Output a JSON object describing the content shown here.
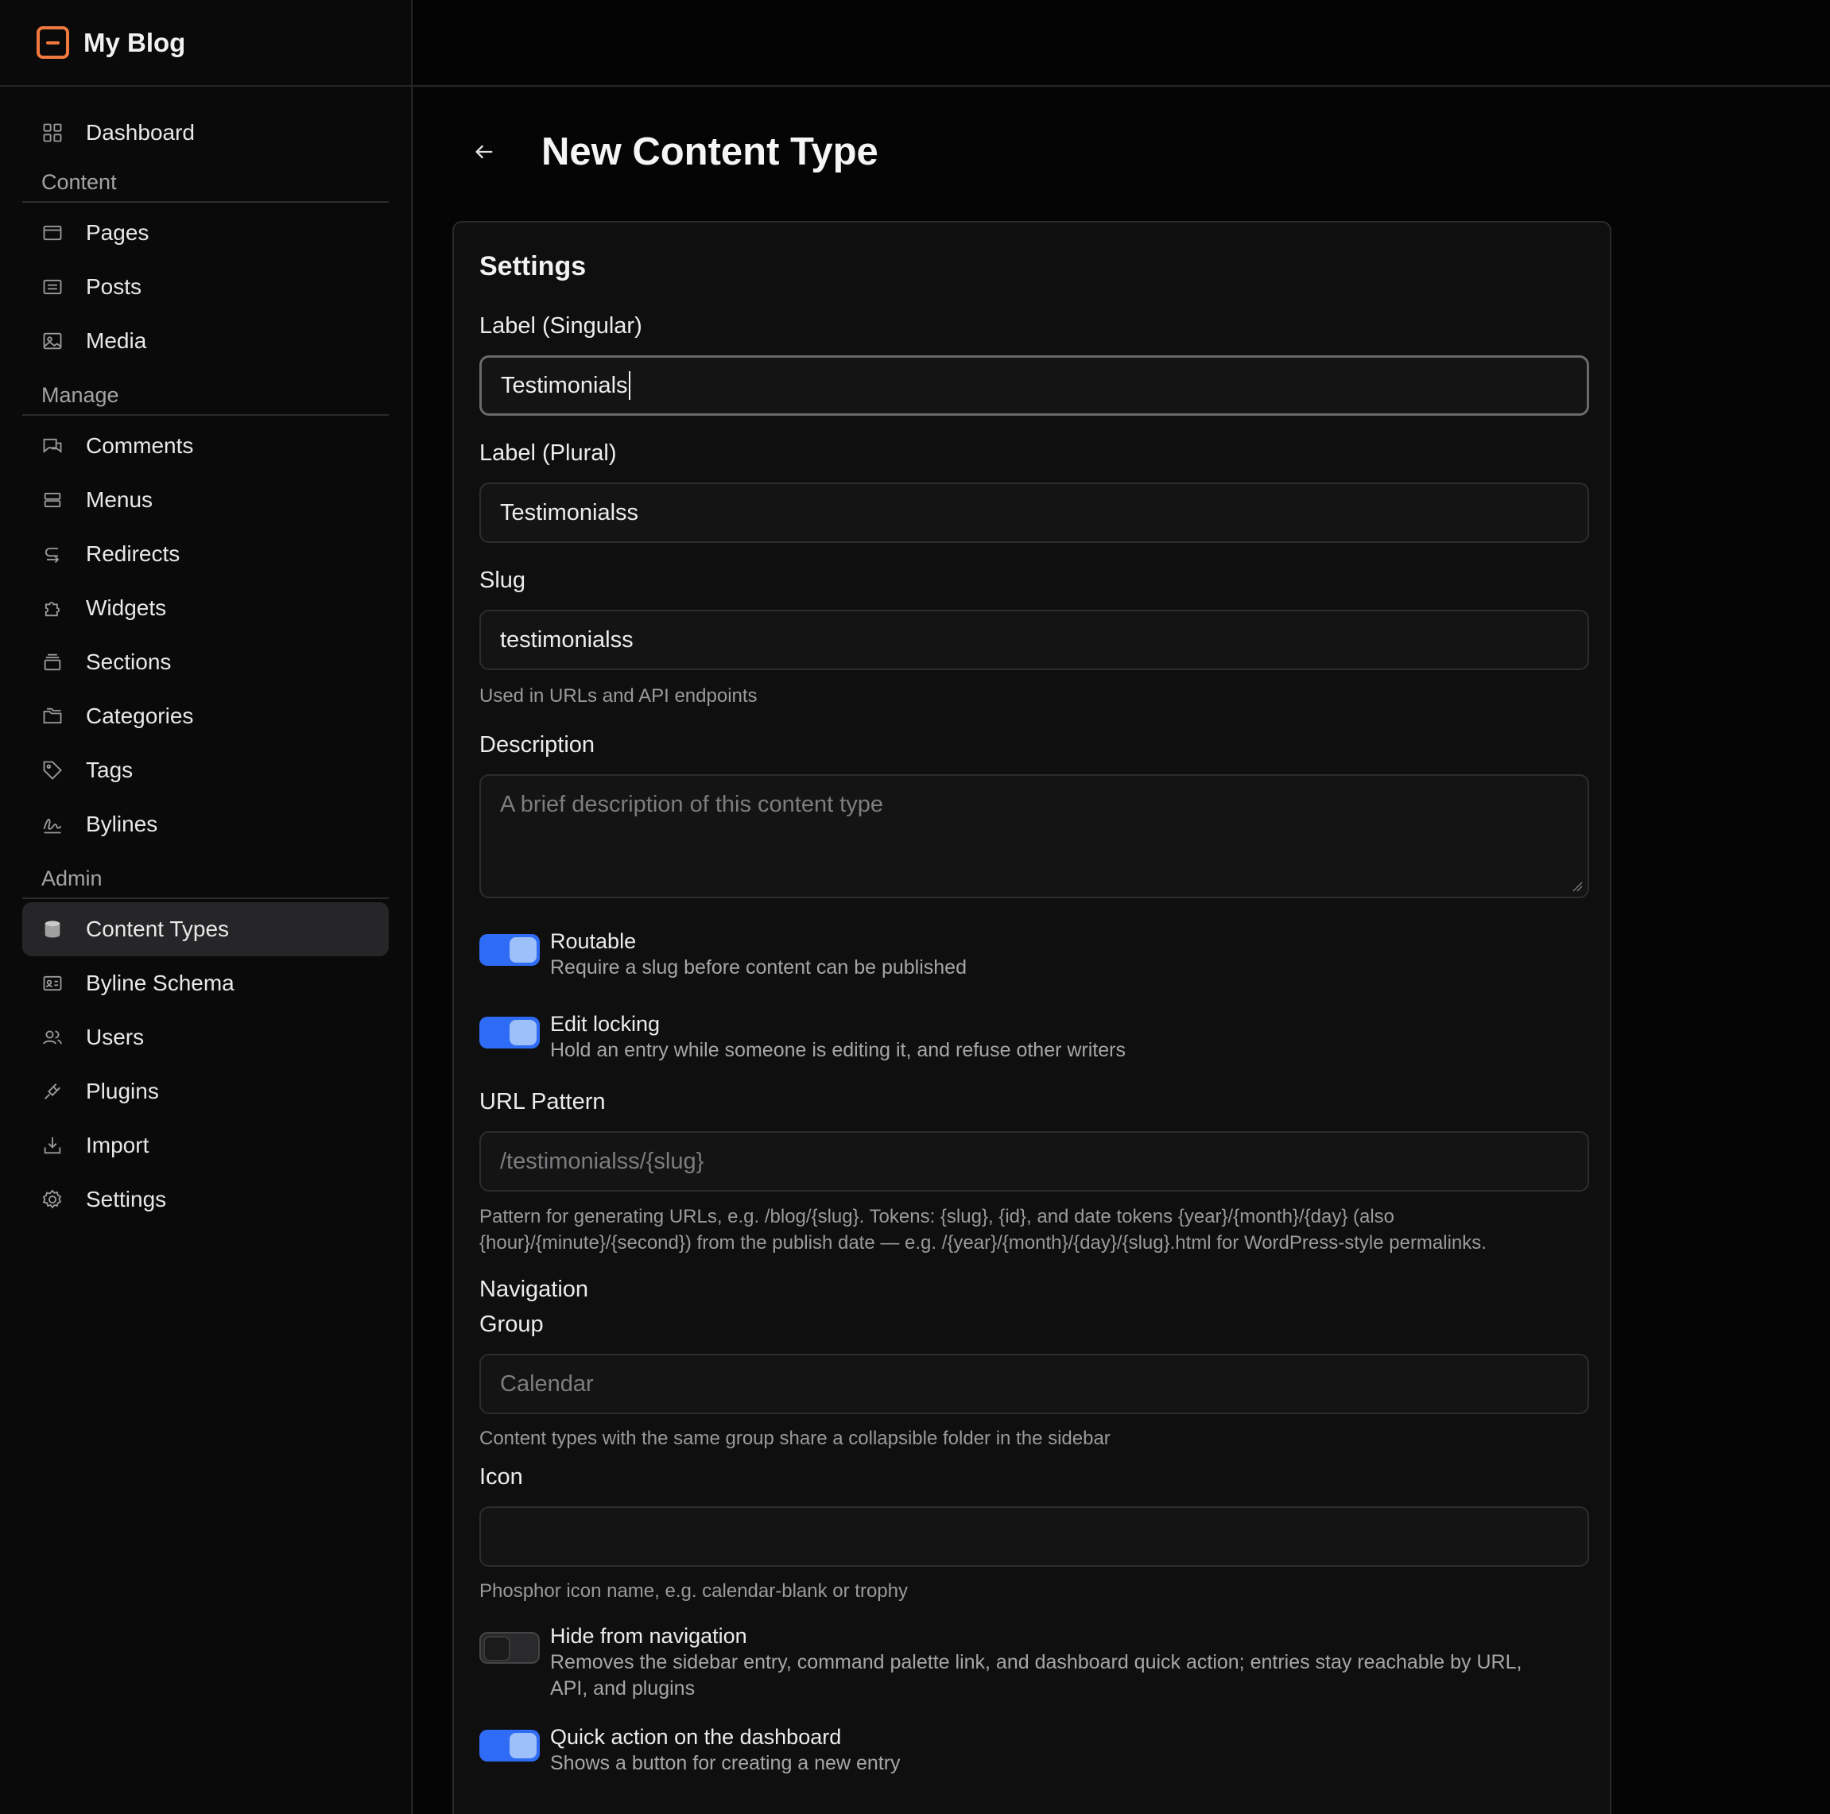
{
  "brand": {
    "name": "My Blog"
  },
  "sidebar": {
    "dashboard": "Dashboard",
    "sections": {
      "content": "Content",
      "manage": "Manage",
      "admin": "Admin"
    },
    "content_items": [
      "Pages",
      "Posts",
      "Media"
    ],
    "manage_items": [
      "Comments",
      "Menus",
      "Redirects",
      "Widgets",
      "Sections",
      "Categories",
      "Tags",
      "Bylines"
    ],
    "admin_items": [
      "Content Types",
      "Byline Schema",
      "Users",
      "Plugins",
      "Import",
      "Settings"
    ],
    "active_item": "Content Types"
  },
  "page": {
    "title": "New Content Type"
  },
  "form": {
    "section_title": "Settings",
    "label_singular": {
      "label": "Label (Singular)",
      "value": "Testimonials"
    },
    "label_plural": {
      "label": "Label (Plural)",
      "value": "Testimonialss"
    },
    "slug": {
      "label": "Slug",
      "value": "testimonialss",
      "help": "Used in URLs and API endpoints"
    },
    "description": {
      "label": "Description",
      "placeholder": "A brief description of this content type"
    },
    "routable": {
      "title": "Routable",
      "desc": "Require a slug before content can be published",
      "on": true
    },
    "edit_locking": {
      "title": "Edit locking",
      "desc": "Hold an entry while someone is editing it, and refuse other writers",
      "on": true
    },
    "url_pattern": {
      "label": "URL Pattern",
      "placeholder": "/testimonialss/{slug}",
      "help_line1": "Pattern for generating URLs, e.g. /blog/{slug}. Tokens: {slug}, {id}, and date tokens {year}/{month}/{day} (also",
      "help_line2": "{hour}/{minute}/{second}) from the publish date — e.g. /{year}/{month}/{day}/{slug}.html for WordPress-style permalinks."
    },
    "navigation": {
      "heading": "Navigation"
    },
    "group": {
      "label": "Group",
      "placeholder": "Calendar",
      "help": "Content types with the same group share a collapsible folder in the sidebar"
    },
    "icon": {
      "label": "Icon",
      "value": "",
      "help": "Phosphor icon name, e.g. calendar-blank or trophy"
    },
    "hide_nav": {
      "title": "Hide from navigation",
      "desc_line1": "Removes the sidebar entry, command palette link, and dashboard quick action; entries stay reachable by URL,",
      "desc_line2": "API, and plugins",
      "on": false
    },
    "quick_action": {
      "title": "Quick action on the dashboard",
      "desc": "Shows a button for creating a new entry",
      "on": true
    }
  },
  "colors": {
    "accent": "#2f6cf5",
    "brand": "#f0793f",
    "background": "#050505"
  }
}
